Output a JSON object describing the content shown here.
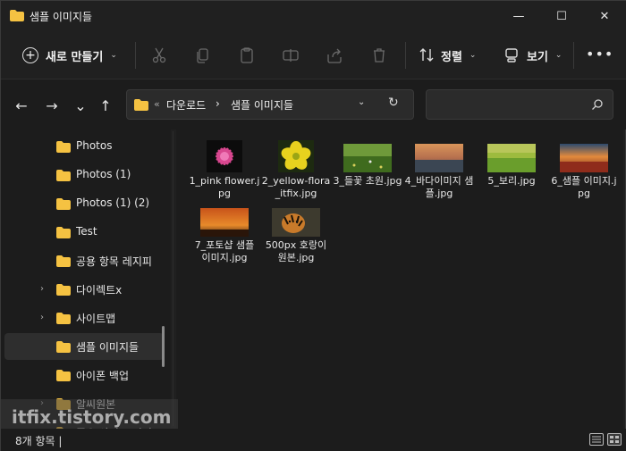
{
  "window": {
    "title": "샘플 이미지들",
    "controls": {
      "minimize": "—",
      "maximize": "☐",
      "close": "✕"
    }
  },
  "toolbar": {
    "new_label": "새로 만들기",
    "sort_label": "정렬",
    "view_label": "보기",
    "more_label": "•••",
    "icons": [
      "cut-icon",
      "copy-icon",
      "paste-icon",
      "rename-icon",
      "share-icon",
      "delete-icon"
    ]
  },
  "navigation": {
    "back": "←",
    "forward": "→",
    "recent": "⌄",
    "up": "↑"
  },
  "address": {
    "overflow": "«",
    "segments": [
      "다운로드",
      "샘플 이미지들"
    ],
    "separator": "›"
  },
  "search": {
    "placeholder": ""
  },
  "sidebar": {
    "items": [
      {
        "label": "Photos",
        "has_chevron": false,
        "selected": false
      },
      {
        "label": "Photos (1)",
        "has_chevron": false,
        "selected": false
      },
      {
        "label": "Photos (1) (2)",
        "has_chevron": false,
        "selected": false
      },
      {
        "label": "Test",
        "has_chevron": false,
        "selected": false
      },
      {
        "label": "공용 항목 레지피",
        "has_chevron": false,
        "selected": false
      },
      {
        "label": "다이렉트x",
        "has_chevron": true,
        "selected": false
      },
      {
        "label": "사이트맵",
        "has_chevron": true,
        "selected": false
      },
      {
        "label": "샘플 이미지들",
        "has_chevron": false,
        "selected": true
      },
      {
        "label": "아이폰 백업",
        "has_chevron": false,
        "selected": false
      },
      {
        "label": "알씨원본",
        "has_chevron": true,
        "selected": false
      },
      {
        "label": "중요 사이트 이미",
        "has_chevron": true,
        "selected": false
      }
    ]
  },
  "files": [
    {
      "name": "1_pink flower.jpg",
      "thumb": "pink-flower"
    },
    {
      "name": "2_yellow-flora_itfix.jpg",
      "thumb": "yellow-flower"
    },
    {
      "name": "3_들꽃 초원.jpg",
      "thumb": "meadow"
    },
    {
      "name": "4_바다이미지 샘플.jpg",
      "thumb": "sea"
    },
    {
      "name": "5_보리.jpg",
      "thumb": "barley"
    },
    {
      "name": "6_샘플 이미지.jpg",
      "thumb": "sunset-field"
    },
    {
      "name": "7_포토샵 샘플 이미지.jpg",
      "thumb": "orange-sky"
    },
    {
      "name": "500px 호랑이 원본.jpg",
      "thumb": "tiger"
    }
  ],
  "status": {
    "count_text": "8개 항목  |"
  },
  "watermark": "itfix.tistory.com",
  "colors": {
    "folder": "#f5c242",
    "background": "#202020",
    "pane": "#1c1c1c"
  }
}
